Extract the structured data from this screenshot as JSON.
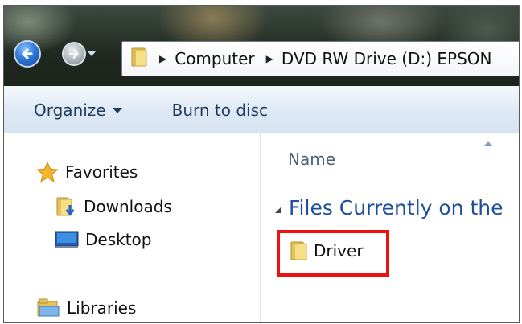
{
  "navigation": {
    "back_icon": "arrow-left-icon",
    "forward_icon": "arrow-right-icon"
  },
  "address_bar": {
    "crumbs": [
      "Computer",
      "DVD RW Drive (D:) EPSON"
    ]
  },
  "command_bar": {
    "organize_label": "Organize",
    "burn_label": "Burn to disc"
  },
  "nav_pane": {
    "favorites_label": "Favorites",
    "downloads_label": "Downloads",
    "desktop_label": "Desktop",
    "libraries_label": "Libraries"
  },
  "content": {
    "column_name": "Name",
    "group_header": "Files Currently on the",
    "items": [
      {
        "name": "Driver",
        "icon": "folder-icon"
      }
    ]
  },
  "colors": {
    "highlight": "#ee1111",
    "group_header": "#1f4f9b"
  }
}
